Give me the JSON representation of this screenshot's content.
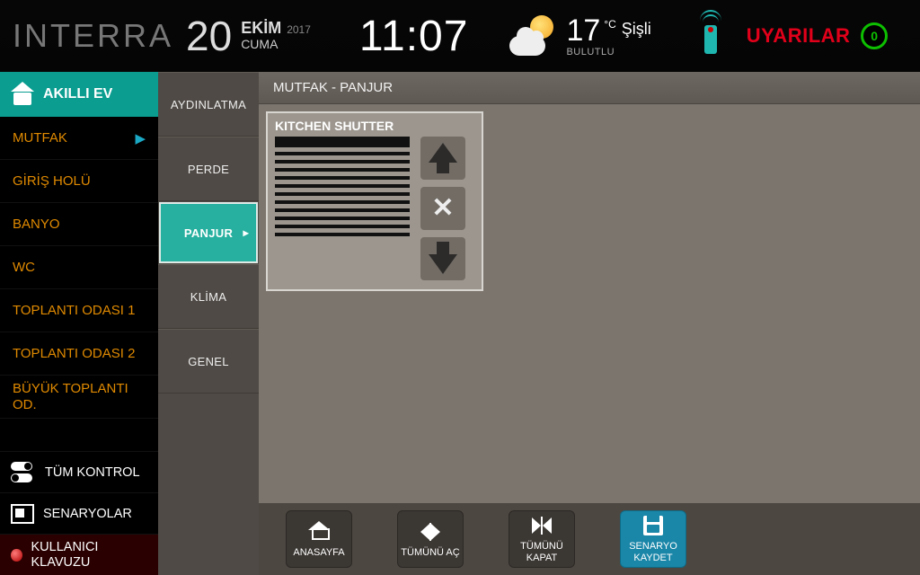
{
  "header": {
    "brand": "INTERRA",
    "date": {
      "day": "20",
      "month": "EKİM",
      "year": "2017",
      "dow": "CUMA"
    },
    "clock": "11:07",
    "weather": {
      "temp": "17",
      "unit": "°C",
      "city": "Şişli",
      "condition": "BULUTLU"
    },
    "alerts_label": "UYARILAR",
    "alerts_count": "0"
  },
  "rooms": {
    "header": "AKILLI EV",
    "items": [
      {
        "label": "MUTFAK",
        "active": true
      },
      {
        "label": "GİRİŞ HOLÜ"
      },
      {
        "label": "BANYO"
      },
      {
        "label": "WC"
      },
      {
        "label": "TOPLANTI ODASI 1"
      },
      {
        "label": "TOPLANTI ODASI 2"
      },
      {
        "label": "BÜYÜK TOPLANTI OD."
      }
    ],
    "aux": {
      "all_control": "TÜM KONTROL",
      "scenarios": "SENARYOLAR",
      "guide": "KULLANICI KLAVUZU"
    }
  },
  "categories": [
    {
      "label": "AYDINLATMA"
    },
    {
      "label": "PERDE"
    },
    {
      "label": "PANJUR",
      "active": true
    },
    {
      "label": "KLİMA"
    },
    {
      "label": "GENEL"
    }
  ],
  "breadcrumb": "MUTFAK - PANJUR",
  "device": {
    "title": "KITCHEN SHUTTER"
  },
  "bottom": {
    "home": "ANASAYFA",
    "open_all": "TÜMÜNÜ AÇ",
    "close_all": "TÜMÜNÜ KAPAT",
    "save_scene": "SENARYO KAYDET"
  }
}
